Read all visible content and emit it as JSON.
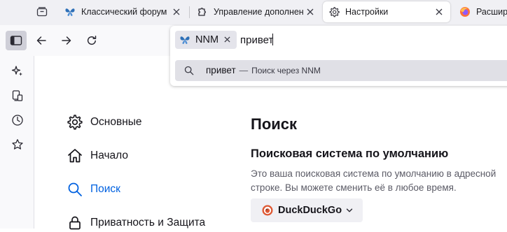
{
  "tabs": [
    {
      "label": "Классический форум-тр",
      "icon": "butterfly-icon",
      "active": false
    },
    {
      "label": "Управление дополнени",
      "icon": "puzzle-icon",
      "active": false
    },
    {
      "label": "Настройки",
      "icon": "gear-icon",
      "active": true
    },
    {
      "label": "Расшире",
      "icon": "firefox-icon",
      "active": false
    }
  ],
  "urlbar": {
    "engine_chip_label": "NNM",
    "input_value": "привет",
    "suggestion": {
      "query": "привет",
      "separator": "—",
      "action": "Поиск через NNM"
    }
  },
  "settings_nav": {
    "items": [
      {
        "label": "Основные",
        "icon": "gear-icon"
      },
      {
        "label": "Начало",
        "icon": "home-icon"
      },
      {
        "label": "Поиск",
        "icon": "search-icon",
        "selected": true
      },
      {
        "label": "Приватность и Защита",
        "icon": "lock-icon"
      }
    ]
  },
  "main": {
    "page_title": "Поиск",
    "section_heading": "Поисковая система по умолчанию",
    "section_desc": "Это ваша поисковая система по умолчанию в адресной строке. Вы можете сменить её в любое время.",
    "default_engine": "DuckDuckGo"
  },
  "colors": {
    "accent": "#0061e0",
    "tabstrip_bg": "#f0f0f4",
    "toolbar_bg": "#f9f9fb",
    "suggestion_bg": "#e0e0e6",
    "duckduckgo": "#de5833"
  }
}
